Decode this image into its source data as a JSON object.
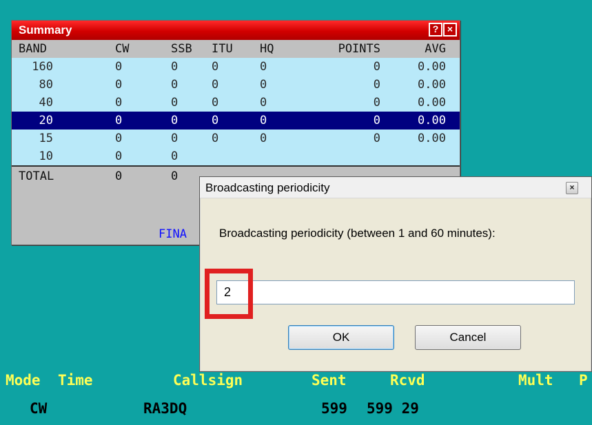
{
  "summary": {
    "title": "Summary",
    "help_label": "?",
    "close_label": "×",
    "columns": [
      "BAND",
      "CW",
      "SSB",
      "ITU",
      "HQ",
      "POINTS",
      "AVG"
    ],
    "rows": [
      {
        "band": "160",
        "cw": "0",
        "ssb": "0",
        "itu": "0",
        "hq": "0",
        "points": "0",
        "avg": "0.00"
      },
      {
        "band": "80",
        "cw": "0",
        "ssb": "0",
        "itu": "0",
        "hq": "0",
        "points": "0",
        "avg": "0.00"
      },
      {
        "band": "40",
        "cw": "0",
        "ssb": "0",
        "itu": "0",
        "hq": "0",
        "points": "0",
        "avg": "0.00"
      },
      {
        "band": "20",
        "cw": "0",
        "ssb": "0",
        "itu": "0",
        "hq": "0",
        "points": "0",
        "avg": "0.00",
        "selected": true
      },
      {
        "band": "15",
        "cw": "0",
        "ssb": "0",
        "itu": "0",
        "hq": "0",
        "points": "0",
        "avg": "0.00"
      },
      {
        "band": "10",
        "cw": "0",
        "ssb": "0"
      }
    ],
    "total": {
      "label": "TOTAL",
      "cw": "0",
      "ssb": "0"
    },
    "footer_text": "FINA"
  },
  "dialog": {
    "title": "Broadcasting periodicity",
    "close_label": "×",
    "prompt": "Broadcasting periodicity (between 1 and 60 minutes):",
    "input_value": "2",
    "ok_label": "OK",
    "cancel_label": "Cancel"
  },
  "status": {
    "headers": {
      "mode": "Mode",
      "time": "Time",
      "callsign": "Callsign",
      "sent": "Sent",
      "rcvd": "Rcvd",
      "mult": "Mult",
      "p": "P"
    },
    "values": {
      "mode": "CW",
      "callsign": "RA3DQ",
      "sent": "599",
      "rcvd": "599 29"
    }
  },
  "colors": {
    "background": "#0ea3a3",
    "title_red": "#d10000",
    "row_light": "#b9e9f9",
    "row_selected": "#000080",
    "status_header": "#ffff55",
    "highlight": "#e02020"
  }
}
